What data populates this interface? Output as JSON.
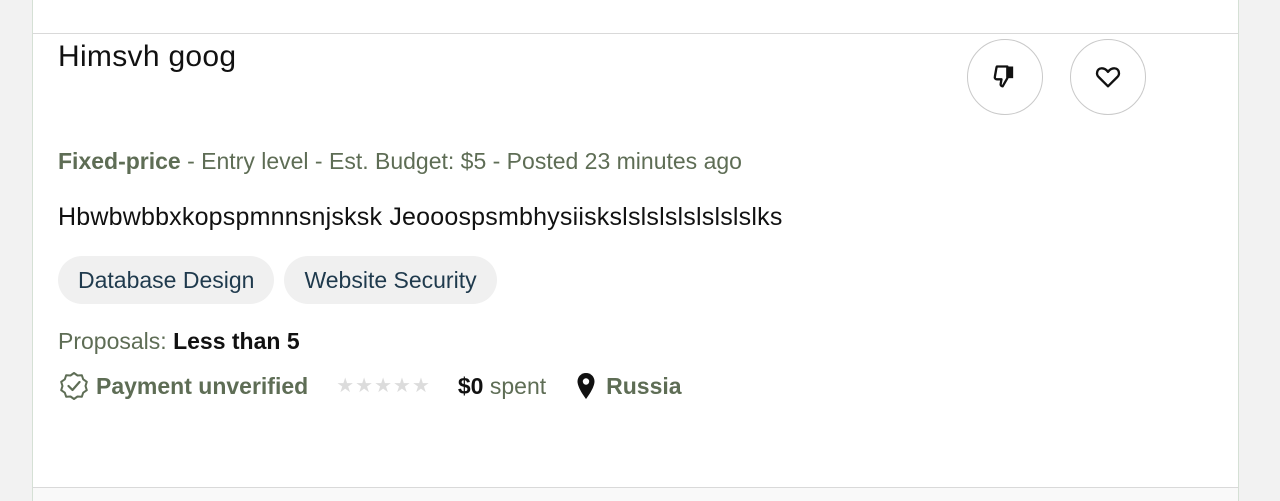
{
  "job": {
    "title": "Himsvh goog",
    "payment_type": "Fixed-price",
    "meta_rest": " - Entry level - Est. Budget: $5 - Posted 23 minutes ago",
    "description": "Hbwbwbbxkopspmnnsnjsksk Jeooospsmbhysiiskslslslslslslslslks",
    "skills": [
      "Database Design",
      "Website Security"
    ],
    "proposals_label": "Proposals: ",
    "proposals_value": "Less than 5",
    "payment_status": "Payment unverified",
    "rating_stars": 0,
    "spent_amount": "$0",
    "spent_label": " spent",
    "location": "Russia"
  },
  "icons": {
    "dislike": "thumbs-down-icon",
    "save": "heart-icon",
    "payment": "verified-badge-icon",
    "location": "map-pin-icon"
  }
}
